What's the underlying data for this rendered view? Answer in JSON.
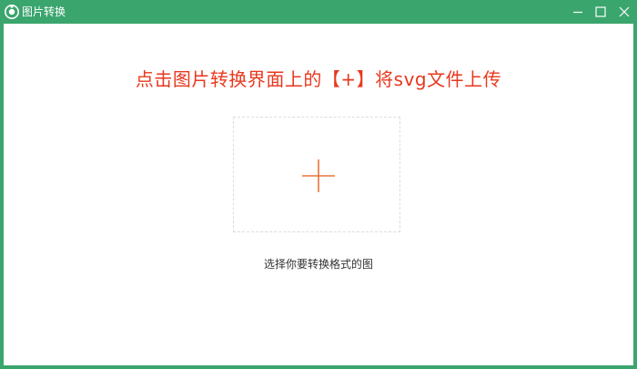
{
  "window": {
    "title": "图片转换",
    "accent_color": "#3aa56d",
    "controls": [
      "minimize-icon",
      "maximize-icon",
      "close-icon"
    ]
  },
  "main": {
    "headline": "点击图片转换界面上的【+】将svg文件上传",
    "headline_color": "#e8381e",
    "upload_icon": "plus-icon",
    "upload_icon_color": "#e8743b",
    "hint": "选择你要转换格式的图"
  }
}
